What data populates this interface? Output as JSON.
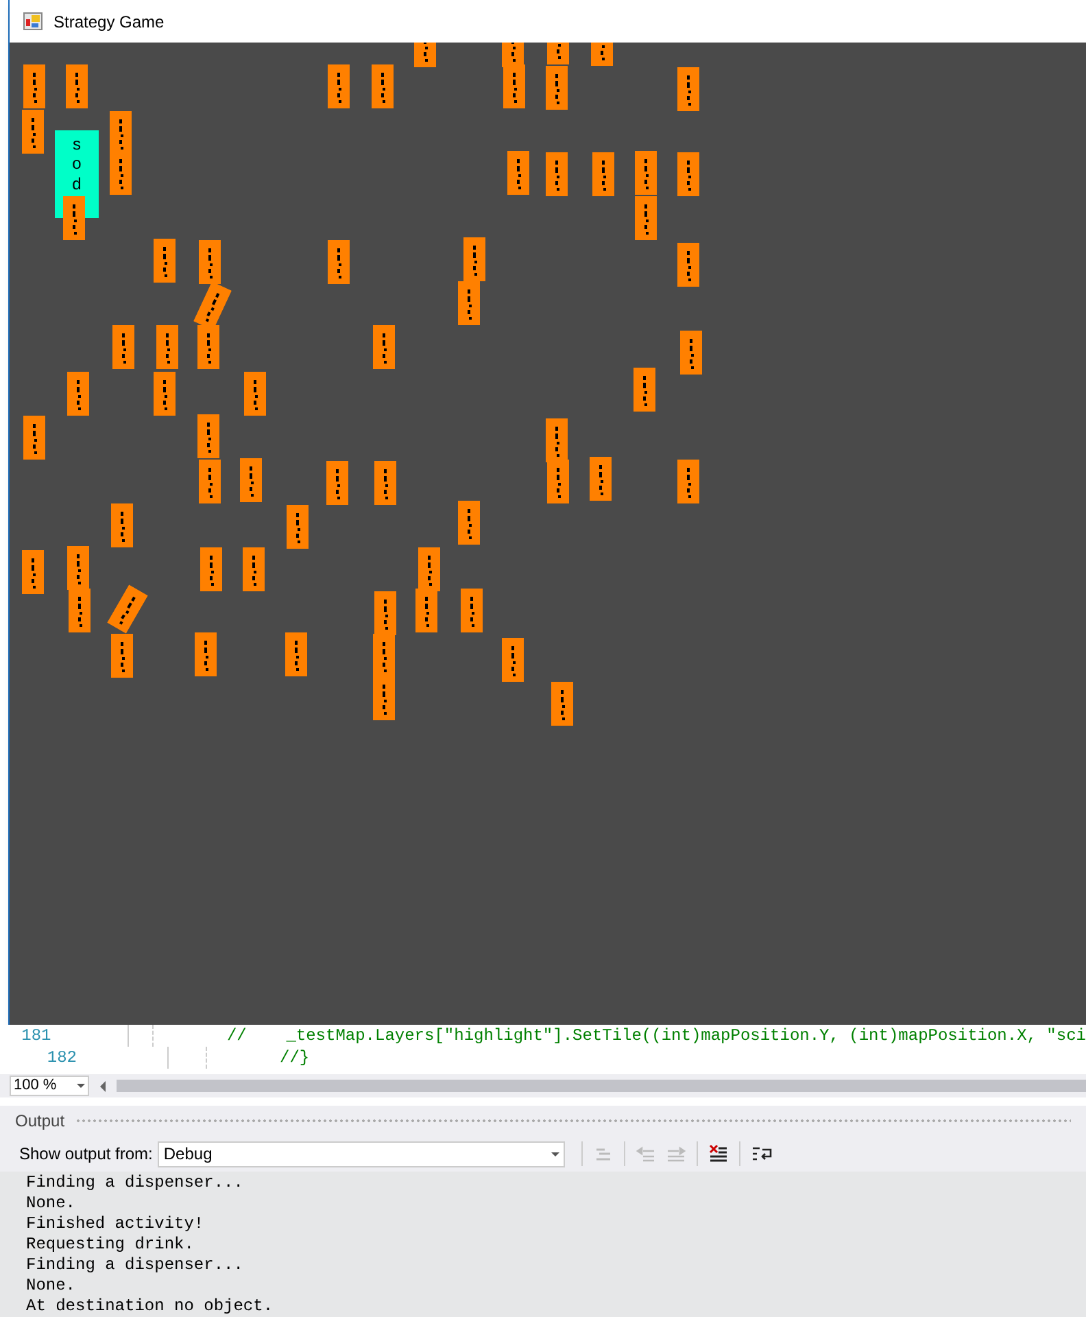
{
  "window": {
    "title": "Strategy Game"
  },
  "map": {
    "selected_tile": {
      "label": "sod"
    }
  },
  "editor": {
    "lines": [
      {
        "number": "181",
        "code": "//    _testMap.Layers[\"highlight\"].SetTile((int)mapPosition.Y, (int)mapPosition.X, \"sci"
      },
      {
        "number": "182",
        "code": "//}"
      }
    ],
    "zoom": "100 %"
  },
  "output": {
    "title": "Output",
    "source_label": "Show output from:",
    "source": "Debug",
    "lines": [
      "Finding a dispenser...",
      "None.",
      "Finished activity!",
      "Requesting drink.",
      "Finding a dispenser...",
      "None.",
      "At destination no object."
    ]
  }
}
